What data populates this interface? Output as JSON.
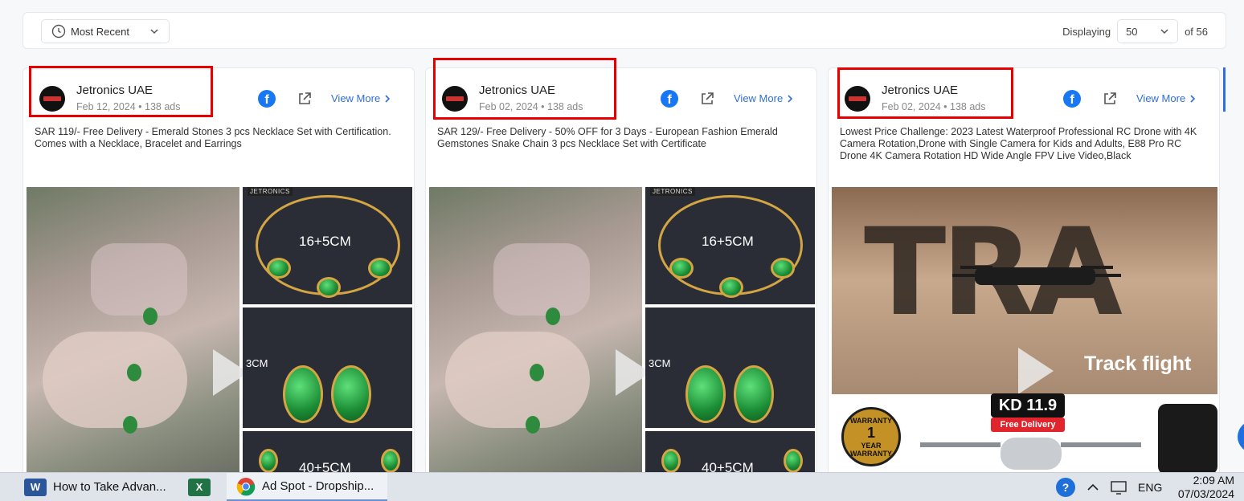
{
  "toolbar": {
    "sort_label": "Most Recent",
    "displaying_label": "Displaying",
    "per_page": "50",
    "total_label": "of 56"
  },
  "cards": [
    {
      "advertiser": "Jetronics UAE",
      "date": "Feb 12, 2024",
      "ads": "138 ads",
      "view_more": "View More",
      "description": "SAR 119/- Free Delivery - Emerald Stones 3 pcs Necklace Set with Certification. Comes with a Necklace, Bracelet and Earrings",
      "thumb_labels": [
        "16+5CM",
        "3CM",
        "40+5CM"
      ],
      "watermark": "JETRONICS"
    },
    {
      "advertiser": "Jetronics UAE",
      "date": "Feb 02, 2024",
      "ads": "138 ads",
      "view_more": "View More",
      "description": "SAR 129/- Free Delivery - 50% OFF for 3 Days - European Fashion Emerald Gemstones Snake Chain 3 pcs Necklace Set with Certificate",
      "thumb_labels": [
        "16+5CM",
        "3CM",
        "40+5CM"
      ],
      "watermark": "JETRONICS"
    },
    {
      "advertiser": "Jetronics UAE",
      "date": "Feb 02, 2024",
      "ads": "138 ads",
      "view_more": "View More",
      "description": "Lowest Price Challenge: 2023 Latest Waterproof Professional RC Drone with 4K Camera Rotation,Drone with Single Camera for Kids and Adults, E88 Pro RC Drone 4K Camera Rotation HD Wide Angle FPV Live Video,Black",
      "video_text_big": "TRA",
      "video_text": "Track flight",
      "price": "KD 11.9",
      "free_delivery": "Free Delivery",
      "warranty_top": "WARRANTY",
      "warranty_num": "1",
      "warranty_year": "YEAR",
      "warranty_bottom": "WARRANTY"
    }
  ],
  "taskbar": {
    "word": "How to Take Advan...",
    "chrome": "Ad Spot - Dropship...",
    "lang": "ENG",
    "time": "2:09 AM",
    "date": "07/03/2024"
  },
  "colors": {
    "accent": "#2f6fd6",
    "facebook": "#1877f2",
    "highlight": "#e80000"
  },
  "icons": [
    "clock-icon",
    "chevron-down-icon",
    "facebook-icon",
    "external-link-icon",
    "chevron-right-icon",
    "play-icon"
  ]
}
